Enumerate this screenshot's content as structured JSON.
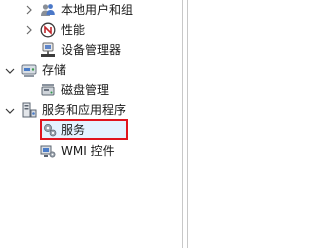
{
  "tree": {
    "items": [
      {
        "label": "本地用户和组",
        "icon": "users-icon",
        "expandable": true,
        "expanded": false
      },
      {
        "label": "性能",
        "icon": "performance-icon",
        "expandable": true,
        "expanded": false
      },
      {
        "label": "设备管理器",
        "icon": "device-manager-icon",
        "expandable": false
      },
      {
        "label": "存储",
        "icon": "storage-icon",
        "expandable": true,
        "expanded": true
      },
      {
        "label": "磁盘管理",
        "icon": "disk-management-icon",
        "expandable": false
      },
      {
        "label": "服务和应用程序",
        "icon": "services-apps-icon",
        "expandable": true,
        "expanded": true
      },
      {
        "label": "服务",
        "icon": "services-gear-icon",
        "expandable": false,
        "selected": true
      },
      {
        "label": "WMI 控件",
        "icon": "wmi-control-icon",
        "expandable": false
      }
    ]
  },
  "colors": {
    "highlight_border": "#e0141e",
    "selection_fill": "#cde8ff",
    "splitter": "#c8c8c8"
  }
}
